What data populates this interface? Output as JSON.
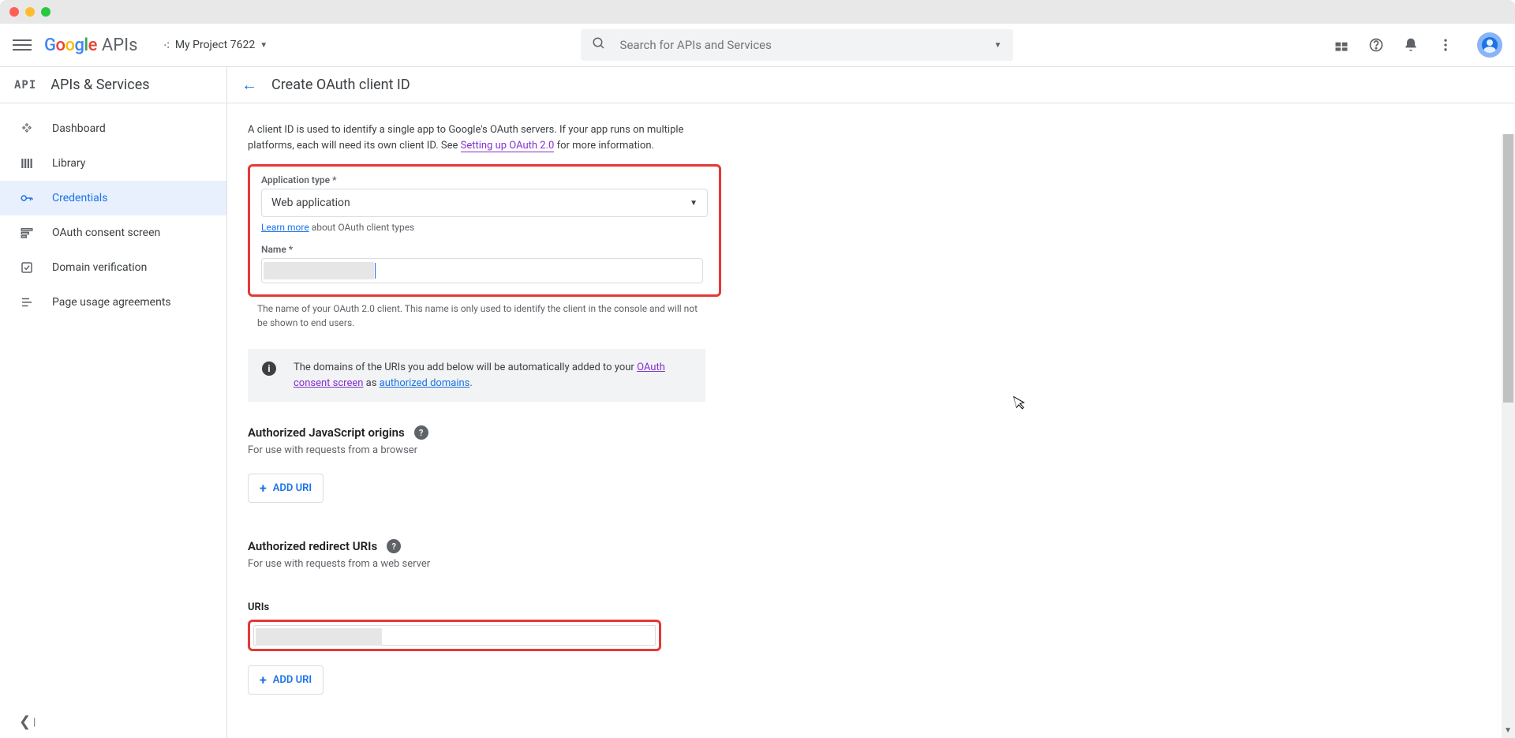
{
  "topbar": {
    "logo_suffix": "APIs",
    "project_name": "My Project 7622",
    "search_placeholder": "Search for APIs and Services"
  },
  "sidebar": {
    "heading": "APIs & Services",
    "items": [
      {
        "label": "Dashboard"
      },
      {
        "label": "Library"
      },
      {
        "label": "Credentials"
      },
      {
        "label": "OAuth consent screen"
      },
      {
        "label": "Domain verification"
      },
      {
        "label": "Page usage agreements"
      }
    ]
  },
  "page": {
    "title": "Create OAuth client ID",
    "intro_prefix": "A client ID is used to identify a single app to Google's OAuth servers. If your app runs on multiple platforms, each will need its own client ID. See ",
    "intro_link": "Setting up OAuth 2.0",
    "intro_suffix": " for more information.",
    "app_type_label": "Application type *",
    "app_type_value": "Web application",
    "learn_more": "Learn more",
    "learn_more_suffix": " about OAuth client types",
    "name_label": "Name *",
    "name_helper": "The name of your OAuth 2.0 client. This name is only used to identify the client in the console and will not be shown to end users.",
    "info_prefix": "The domains of the URIs you add below will be automatically added to your ",
    "info_link1": "OAuth consent screen",
    "info_mid": " as ",
    "info_link2": "authorized domains",
    "info_end": ".",
    "js_origins_title": "Authorized JavaScript origins",
    "js_origins_sub": "For use with requests from a browser",
    "redirect_title": "Authorized redirect URIs",
    "redirect_sub": "For use with requests from a web server",
    "uris_label": "URIs",
    "add_uri_label": "ADD URI"
  }
}
